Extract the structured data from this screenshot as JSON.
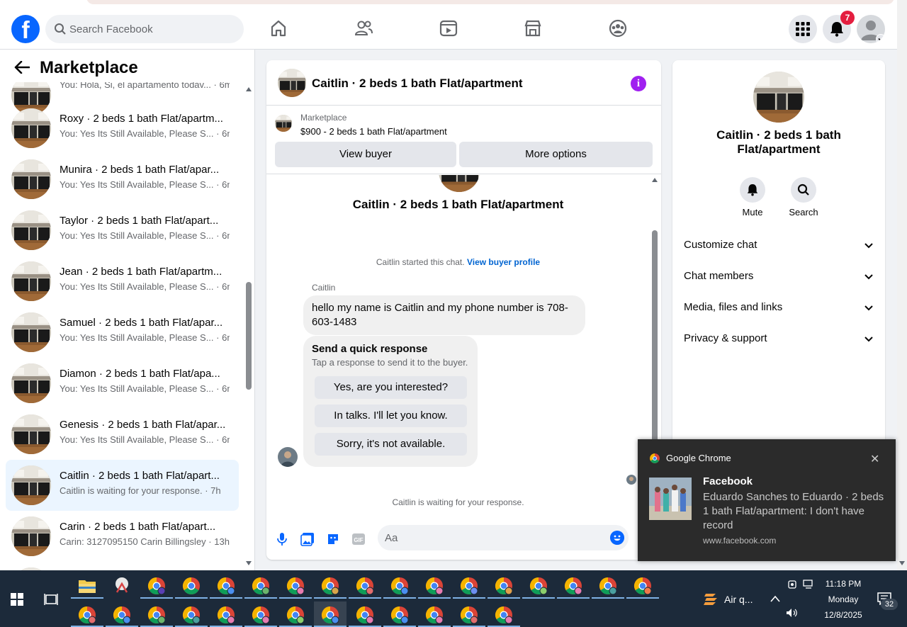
{
  "topbar": {
    "search_placeholder": "Search Facebook",
    "notification_count": "7"
  },
  "marketplace": {
    "title": "Marketplace",
    "partial_top_snippet": "You: Hola, Si, el apartamento todav... · 6m",
    "conversations": [
      {
        "name": "Roxy · 2 beds 1 bath Flat/apartm...",
        "snippet": "You: Yes Its Still Available, Please S... · 6m"
      },
      {
        "name": "Munira · 2 beds 1 bath Flat/apar...",
        "snippet": "You: Yes Its Still Available, Please S... · 6m"
      },
      {
        "name": "Taylor · 2 beds 1 bath Flat/apart...",
        "snippet": "You: Yes Its Still Available, Please S... · 6m"
      },
      {
        "name": "Jean · 2 beds 1 bath Flat/apartm...",
        "snippet": "You: Yes Its Still Available, Please S... · 6m"
      },
      {
        "name": "Samuel · 2 beds 1 bath Flat/apar...",
        "snippet": "You: Yes Its Still Available, Please S... · 6m"
      },
      {
        "name": "Diamon · 2 beds 1 bath Flat/apa...",
        "snippet": "You: Yes Its Still Available, Please S... · 6m"
      },
      {
        "name": "Genesis · 2 beds 1 bath Flat/apar...",
        "snippet": "You: Yes Its Still Available, Please S... · 6m"
      },
      {
        "name": "Caitlin · 2 beds 1 bath Flat/apart...",
        "snippet": "Caitlin is waiting for your response. · 7h"
      },
      {
        "name": "Carin · 2 beds 1 bath Flat/apart...",
        "snippet": "Carin: 3127095150 Carin Billingsley · 13h"
      }
    ]
  },
  "chat": {
    "header_title": "Caitlin · 2 beds 1 bath Flat/apartment",
    "marketplace_label": "Marketplace",
    "listing_price": "$900 - 2 beds 1 bath Flat/apartment",
    "view_buyer": "View buyer",
    "more_options": "More options",
    "body_title": "Caitlin · 2 beds 1 bath Flat/apartment",
    "started_text": "Caitlin started this chat.",
    "view_buyer_profile": "View buyer profile",
    "sender_name": "Caitlin",
    "message": "hello my name is Caitlin and my phone number is 708-603-1483",
    "quick_title": "Send a quick response",
    "quick_subtitle": "Tap a response to send it to the buyer.",
    "quick_options": [
      "Yes, are you interested?",
      "In talks. I'll let you know.",
      "Sorry, it's not available."
    ],
    "waiting_text": "Caitlin is waiting for your response.",
    "input_placeholder": "Aa"
  },
  "info_panel": {
    "title": "Caitlin · 2 beds 1 bath Flat/apartment",
    "mute": "Mute",
    "search": "Search",
    "sections": [
      "Customize chat",
      "Chat members",
      "Media, files and links",
      "Privacy & support"
    ]
  },
  "notification": {
    "app": "Google Chrome",
    "title": "Facebook",
    "message": "Eduardo Sanches to Eduardo · 2 beds 1 bath Flat/apartment: I don't have record",
    "url": "www.facebook.com"
  },
  "taskbar": {
    "weather": "Air q...",
    "time": "11:18 PM",
    "day": "Monday",
    "date": "12/8/2025",
    "notif_count": "32"
  },
  "colors": {
    "facebook_blue": "#0866ff",
    "badge_red": "#e41e3f",
    "info_purple": "#a020f0",
    "link_blue": "#0064d1"
  }
}
